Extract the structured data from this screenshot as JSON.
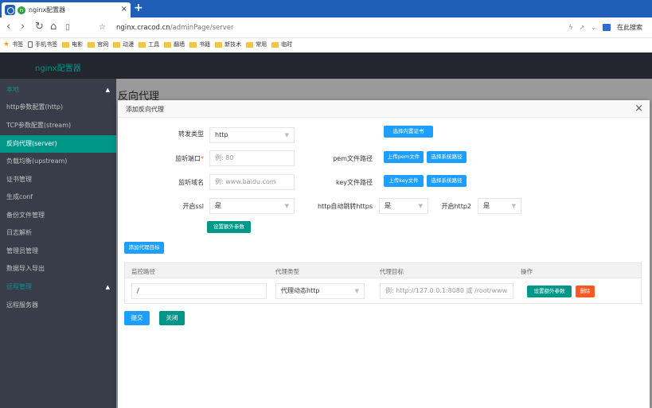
{
  "browser": {
    "tab_title": "nginx配置器",
    "tab_close": "×",
    "new_tab": "+",
    "url_host": "nginx.cracod.cn",
    "url_path": "/adminPage/server",
    "search_label": "在此搜索",
    "bookmarks": [
      "书签",
      "手机书签",
      "电影",
      "官网",
      "动漫",
      "工具",
      "翻墙",
      "书籍",
      "新技术",
      "常用",
      "临时"
    ]
  },
  "app": {
    "brand": "nginx配置器"
  },
  "sidebar": {
    "items": [
      {
        "label": "本地",
        "group": true
      },
      {
        "label": "http参数配置(http)"
      },
      {
        "label": "TCP参数配置(stream)"
      },
      {
        "label": "反向代理(server)",
        "active": true
      },
      {
        "label": "负载均衡(upstream)"
      },
      {
        "label": "证书管理"
      },
      {
        "label": "生成conf"
      },
      {
        "label": "备份文件管理"
      },
      {
        "label": "日志解析"
      },
      {
        "label": "管理员管理"
      },
      {
        "label": "数据导入导出"
      },
      {
        "label": "远程管理",
        "group": true
      },
      {
        "label": "远程服务器"
      }
    ]
  },
  "page": {
    "title": "反向代理"
  },
  "modal": {
    "title": "添加反向代理",
    "close": "×",
    "forward_type": {
      "label": "转发类型",
      "value": "http"
    },
    "listen_port": {
      "label": "监听端口",
      "required": "*",
      "placeholder": "例: 80"
    },
    "listen_domain": {
      "label": "监听域名",
      "placeholder": "例: www.baidu.com"
    },
    "ssl": {
      "label": "开启ssl",
      "value": "是"
    },
    "select_cert_btn": "选择内置证书",
    "pem_path": {
      "label": "pem文件路径",
      "upload_btn": "上传pem文件",
      "system_btn": "选择系统路径"
    },
    "key_path": {
      "label": "key文件路径",
      "upload_btn": "上传key文件",
      "system_btn": "选择系统路径"
    },
    "http_redirect": {
      "label": "http自动跳转https",
      "value": "是"
    },
    "http2": {
      "label": "开启http2",
      "value": "是"
    },
    "extra_params_btn": "设置额外参数",
    "add_target_btn": "添加代理目标",
    "table": {
      "headers": [
        "监控路径",
        "代理类型",
        "代理目标",
        "操作"
      ],
      "row": {
        "path": "/",
        "proxy_type": "代理动态http",
        "target_placeholder": "例: http://127.0.0.1:8080 或 /root/www",
        "extra_btn": "设置额外参数",
        "delete_btn": "删除"
      }
    },
    "submit_btn": "提交",
    "close_btn": "关闭"
  }
}
